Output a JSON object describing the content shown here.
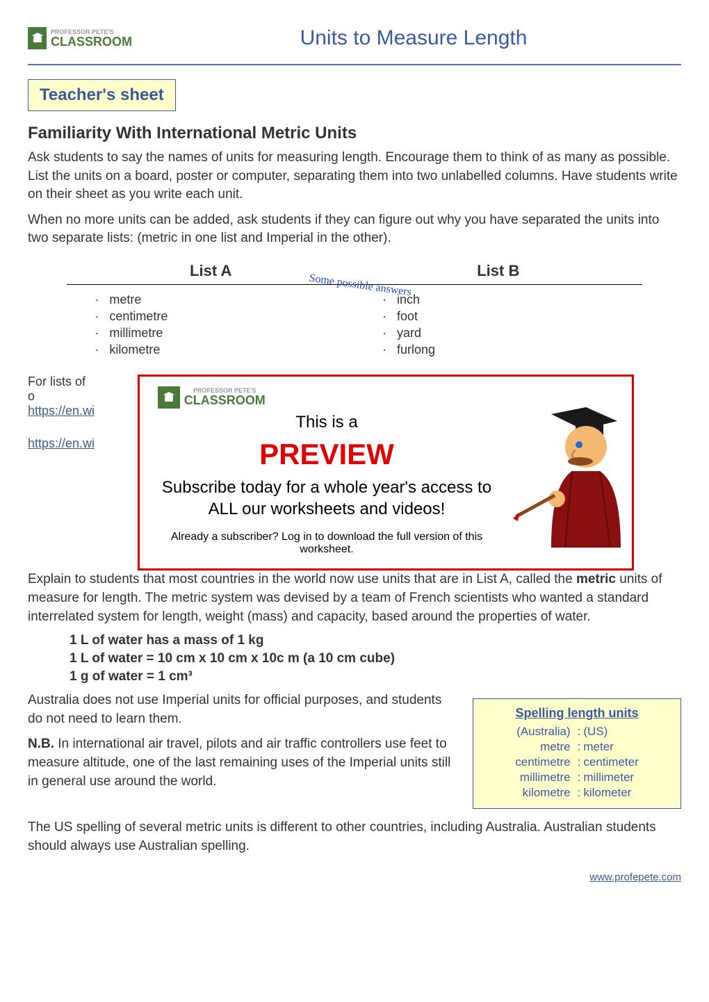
{
  "logo": {
    "top": "PROFESSOR PETE'S",
    "bottom": "CLASSROOM"
  },
  "page_title": "Units to Measure Length",
  "teacher_sheet": "Teacher's sheet",
  "section_heading": "Familiarity With International Metric Units",
  "intro_para_1": "Ask students to say the names of units for measuring length. Encourage them to think of as many as possible. List the units on a board, poster or computer, separating them into two unlabelled columns. Have students write on their sheet as you write each unit.",
  "intro_para_2": "When no more units can be added, ask students if they can figure out why you have separated the units into two separate lists: (metric in one list and Imperial in the other).",
  "lists": {
    "answers_label": "Some possible answers",
    "a": {
      "header": "List A",
      "items": [
        "metre",
        "centimetre",
        "millimetre",
        "kilometre"
      ]
    },
    "b": {
      "header": "List B",
      "items": [
        "inch",
        "foot",
        "yard",
        "furlong"
      ]
    }
  },
  "truncated_left": "For lists of o",
  "link_1": "https://en.wi",
  "link_2": "https://en.wi",
  "preview": {
    "this_is": "This is a",
    "big": "PREVIEW",
    "sub": "Subscribe today for a whole year's access to ALL our worksheets and videos!",
    "footer": "Already a subscriber? Log in to download the full version of this worksheet."
  },
  "explain_para": "Explain to students that most countries in the world now use units that are in List A, called the <b>metric</b> units of measure for length. The metric system was devised by a team of French scientists who wanted a standard interrelated system for length, weight (mass) and capacity, based around the properties of water.",
  "facts": [
    "1 L of water has a  mass of 1 kg",
    "1 L of water = 10 cm x 10 cm x 10c m (a 10 cm cube)",
    "1 g of water = 1 cm³"
  ],
  "aus_para_1": "Australia does not use Imperial units for official purposes, and students do not need to learn them.",
  "aus_para_2": "<b>N.B.</b> In international air travel, pilots and air traffic controllers use feet to measure altitude, one of the last remaining uses of the Imperial units still in general use around the world.",
  "us_para": "The US spelling of several metric units is different to other countries, including Australia. Australian students should always use Australian spelling.",
  "spelling": {
    "title": "Spelling length units",
    "header_left": "(Australia)",
    "header_right": "(US)",
    "rows": [
      {
        "l": "metre",
        "r": "meter"
      },
      {
        "l": "centimetre",
        "r": "centimeter"
      },
      {
        "l": "millimetre",
        "r": "millimeter"
      },
      {
        "l": "kilometre",
        "r": "kilometer"
      }
    ]
  },
  "footer_url": "www.profepete.com",
  "chart_data": {
    "type": "table",
    "title": "Spelling length units",
    "columns": [
      "(Australia)",
      "(US)"
    ],
    "rows": [
      [
        "metre",
        "meter"
      ],
      [
        "centimetre",
        "centimeter"
      ],
      [
        "millimetre",
        "millimeter"
      ],
      [
        "kilometre",
        "kilometer"
      ]
    ]
  }
}
